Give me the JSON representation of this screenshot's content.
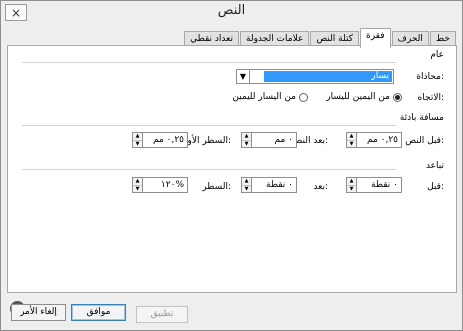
{
  "window": {
    "title": "النص",
    "close_icon": "×"
  },
  "tabs": [
    "خط",
    "الحرف",
    "فقرة",
    "كتلة النص",
    "علامات الجدولة",
    "تعداد نقطي"
  ],
  "active_tab": "فقرة",
  "general": {
    "heading": "عام",
    "alignment_label": "محاذاة:",
    "alignment_value": "يسار",
    "direction_label": "الاتجاه:",
    "rtl_option": "من اليمين لليسار",
    "ltr_option": "من اليسار لليمين"
  },
  "indentation": {
    "heading": "مسافة بادئة",
    "before_text_label": "قبل النص:",
    "before_text_value": "٠,٢٥ مم",
    "after_text_label": "بعد النص:",
    "after_text_value": "٠ مم",
    "first_line_label": "السطر الأول:",
    "first_line_value": "٠,٢٥ مم"
  },
  "spacing": {
    "heading": "تباعد",
    "before_label": "قبل:",
    "before_value": "٠ نقطة",
    "after_label": "بعد:",
    "after_value": "٠ نقطة",
    "line_label": "السطر:",
    "line_value": "١٢٠%"
  },
  "footer": {
    "apply_label": "تطبيق",
    "ok_label": "موافق",
    "cancel_label": "إلغاء الأمر",
    "help_icon": "?"
  }
}
